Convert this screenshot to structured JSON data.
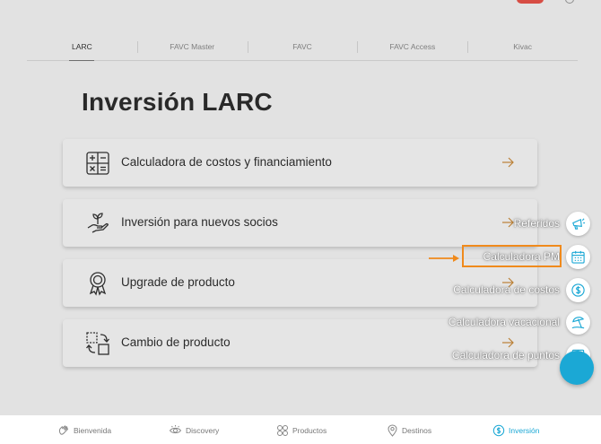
{
  "tabs": [
    {
      "label": "LARC",
      "active": true
    },
    {
      "label": "FAVC Master",
      "active": false
    },
    {
      "label": "FAVC",
      "active": false
    },
    {
      "label": "FAVC Access",
      "active": false
    },
    {
      "label": "Kivac",
      "active": false
    }
  ],
  "page": {
    "title": "Inversión LARC"
  },
  "menu": [
    {
      "label": "Calculadora de costos y financiamiento",
      "icon": "calculator-icon"
    },
    {
      "label": "Inversión para nuevos socios",
      "icon": "plant-hand-icon"
    },
    {
      "label": "Upgrade de producto",
      "icon": "award-ribbon-icon"
    },
    {
      "label": "Cambio de producto",
      "icon": "swap-icon"
    }
  ],
  "fab_menu": [
    {
      "label": "Referidos",
      "icon": "megaphone-icon"
    },
    {
      "label": "Calculadora PM",
      "icon": "calendar-icon",
      "highlighted": true
    },
    {
      "label": "Calculadora de costos",
      "icon": "dollar-coin-icon"
    },
    {
      "label": "Calculadora vacacional",
      "icon": "beach-umbrella-icon"
    },
    {
      "label": "Calculadora de puntos",
      "icon": "points-grid-icon"
    }
  ],
  "bottom_nav": [
    {
      "label": "Bienvenida",
      "icon": "hand-wave-icon",
      "active": false
    },
    {
      "label": "Discovery",
      "icon": "eye-icon",
      "active": false
    },
    {
      "label": "Productos",
      "icon": "products-grid-icon",
      "active": false
    },
    {
      "label": "Destinos",
      "icon": "map-pin-icon",
      "active": false
    },
    {
      "label": "Inversión",
      "icon": "dollar-circle-icon",
      "active": true
    }
  ],
  "colors": {
    "accent": "#1ba8d5",
    "highlight": "#f08a1c",
    "arrow": "#c98a3a"
  }
}
